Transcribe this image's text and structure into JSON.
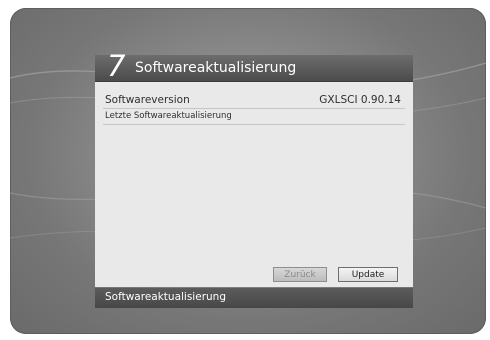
{
  "dialog": {
    "number": "7",
    "title": "Softwareaktualisierung",
    "rows": {
      "software_version_label": "Softwareversion",
      "software_version_value": "GXLSCI 0.90.14",
      "last_update_label": "Letzte Softwareaktualisierung"
    },
    "buttons": {
      "back_label": "Zurück",
      "update_label": "Update"
    },
    "footer": "Softwareaktualisierung"
  }
}
